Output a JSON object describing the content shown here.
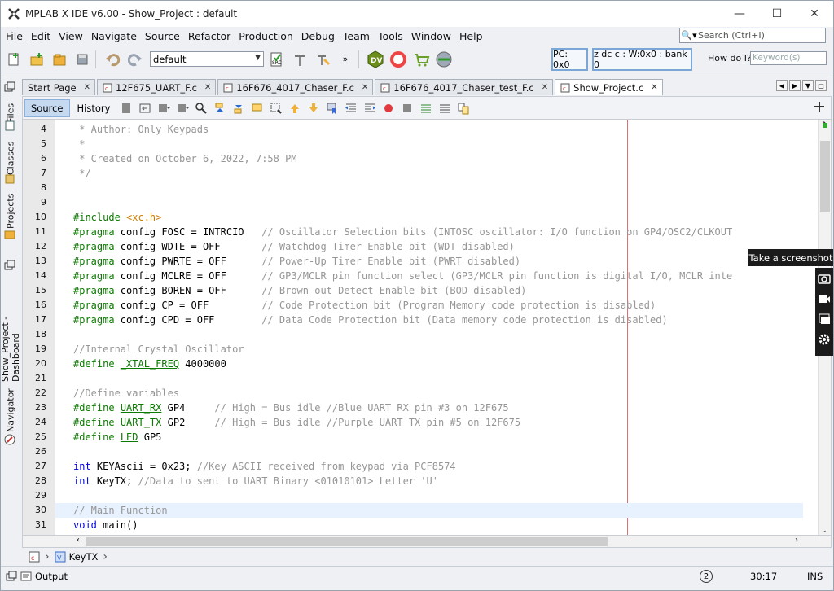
{
  "window": {
    "title": "MPLAB X IDE v6.00 - Show_Project : default",
    "controls": [
      "—",
      "☐",
      "✕"
    ]
  },
  "menu": [
    "File",
    "Edit",
    "View",
    "Navigate",
    "Source",
    "Refactor",
    "Production",
    "Debug",
    "Team",
    "Tools",
    "Window",
    "Help"
  ],
  "search": {
    "placeholder": "Search (Ctrl+I)"
  },
  "toolbar": {
    "config": "default",
    "pc": "PC: 0x0",
    "registers": "z dc c  : W:0x0 : bank 0",
    "howdoi": "How do I?",
    "keyword_placeholder": "Keyword(s)"
  },
  "sidebar": [
    "Files",
    "Classes",
    "Projects",
    "Show_Project - Dashboard",
    "Navigator"
  ],
  "tabs": [
    {
      "label": "Start Page",
      "active": false
    },
    {
      "label": "12F675_UART_F.c",
      "active": false
    },
    {
      "label": "16F676_4017_Chaser_F.c",
      "active": false
    },
    {
      "label": "16F676_4017_Chaser_test_F.c",
      "active": false
    },
    {
      "label": "Show_Project.c",
      "active": true
    }
  ],
  "editor_toolbar": {
    "source": "Source",
    "history": "History"
  },
  "code_lines": [
    {
      "n": "4",
      "t": " * Author: Only Keypads"
    },
    {
      "n": "5",
      "t": " *"
    },
    {
      "n": "6",
      "t": " * Created on October 6, 2022, 7:58 PM"
    },
    {
      "n": "7",
      "t": " */"
    },
    {
      "n": "8",
      "t": ""
    },
    {
      "n": "9",
      "t": ""
    },
    {
      "n": "10",
      "t": "#include <xc.h>"
    },
    {
      "n": "11",
      "t": "#pragma config FOSC = INTRCIO   // Oscillator Selection bits (INTOSC oscillator: I/O function on GP4/OSC2/CLKOUT"
    },
    {
      "n": "12",
      "t": "#pragma config WDTE = OFF       // Watchdog Timer Enable bit (WDT disabled)"
    },
    {
      "n": "13",
      "t": "#pragma config PWRTE = OFF      // Power-Up Timer Enable bit (PWRT disabled)"
    },
    {
      "n": "14",
      "t": "#pragma config MCLRE = OFF      // GP3/MCLR pin function select (GP3/MCLR pin function is digital I/O, MCLR inte"
    },
    {
      "n": "15",
      "t": "#pragma config BOREN = OFF      // Brown-out Detect Enable bit (BOD disabled)"
    },
    {
      "n": "16",
      "t": "#pragma config CP = OFF         // Code Protection bit (Program Memory code protection is disabled)"
    },
    {
      "n": "17",
      "t": "#pragma config CPD = OFF        // Data Code Protection bit (Data memory code protection is disabled)"
    },
    {
      "n": "18",
      "t": ""
    },
    {
      "n": "19",
      "t": "//Internal Crystal Oscillator"
    },
    {
      "n": "20",
      "t": "#define _XTAL_FREQ 4000000"
    },
    {
      "n": "21",
      "t": ""
    },
    {
      "n": "22",
      "t": "//Define variables"
    },
    {
      "n": "23",
      "t": "#define UART_RX GP4     // High = Bus idle //Blue UART RX pin #3 on 12F675"
    },
    {
      "n": "24",
      "t": "#define UART_TX GP2     // High = Bus idle //Purple UART TX pin #5 on 12F675"
    },
    {
      "n": "25",
      "t": "#define LED GP5"
    },
    {
      "n": "26",
      "t": ""
    },
    {
      "n": "27",
      "t": "int KEYAscii = 0x23; //Key ASCII received from keypad via PCF8574"
    },
    {
      "n": "28",
      "t": "int KeyTX; //Data to sent to UART Binary <01010101> Letter 'U'"
    },
    {
      "n": "29",
      "t": ""
    },
    {
      "n": "30",
      "t": "// Main Function"
    },
    {
      "n": "31",
      "t": "void main()"
    }
  ],
  "breadcrumb": {
    "item": "KeyTX"
  },
  "status": {
    "output": "Output",
    "notifications": "2",
    "position": "30:17",
    "mode": "INS"
  },
  "overlay": {
    "tooltip": "Take a screenshot"
  }
}
